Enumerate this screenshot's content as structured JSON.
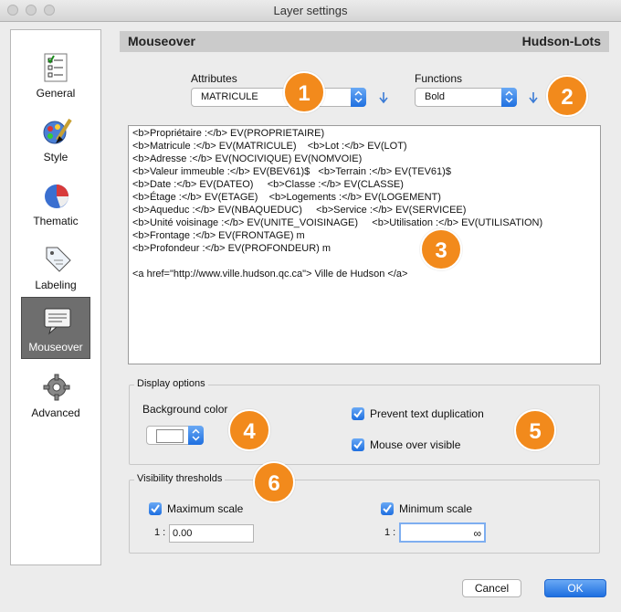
{
  "window": {
    "title": "Layer settings"
  },
  "sidebar": {
    "items": [
      {
        "label": "General",
        "icon": "checklist-icon"
      },
      {
        "label": "Style",
        "icon": "palette-icon"
      },
      {
        "label": "Thematic",
        "icon": "pie-chart-icon"
      },
      {
        "label": "Labeling",
        "icon": "tag-icon"
      },
      {
        "label": "Mouseover",
        "icon": "speech-bubble-icon",
        "active": true
      },
      {
        "label": "Advanced",
        "icon": "gear-icon"
      }
    ]
  },
  "header": {
    "section": "Mouseover",
    "layer": "Hudson-Lots"
  },
  "attributes": {
    "label": "Attributes",
    "value": "MATRICULE"
  },
  "functions": {
    "label": "Functions",
    "value": "Bold"
  },
  "editor": {
    "lines": [
      "<b>Propriétaire :</b> EV(PROPRIETAIRE)",
      "<b>Matricule :</b> EV(MATRICULE)    <b>Lot :</b> EV(LOT)",
      "<b>Adresse :</b> EV(NOCIVIQUE) EV(NOMVOIE)",
      "<b>Valeur immeuble :</b> EV(BEV61)$   <b>Terrain :</b> EV(TEV61)$",
      "<b>Date :</b> EV(DATEO)     <b>Classe :</b> EV(CLASSE)",
      "<b>Étage :</b> EV(ETAGE)    <b>Logements :</b> EV(LOGEMENT)",
      "<b>Aqueduc :</b> EV(NBAQUEDUC)     <b>Service :</b> EV(SERVICEE)",
      "<b>Unité voisinage :</b> EV(UNITE_VOISINAGE)     <b>Utilisation :</b> EV(UTILISATION)",
      "<b>Frontage :</b> EV(FRONTAGE) m",
      "<b>Profondeur :</b> EV(PROFONDEUR) m",
      "",
      "<a href=\"http://www.ville.hudson.qc.ca\"> Ville de Hudson </a>"
    ]
  },
  "display_options": {
    "title": "Display options",
    "background_label": "Background color",
    "background_color": "#ffffff",
    "prevent_dup_label": "Prevent text duplication",
    "prevent_dup_checked": true,
    "mouse_over_label": "Mouse over visible",
    "mouse_over_checked": true
  },
  "visibility": {
    "title": "Visibility thresholds",
    "max_label": "Maximum scale",
    "max_checked": true,
    "max_prefix": "1 :",
    "max_value": "0.00",
    "min_label": "Minimum scale",
    "min_checked": true,
    "min_prefix": "1 :",
    "min_value": "∞"
  },
  "callouts": [
    "1",
    "2",
    "3",
    "4",
    "5",
    "6"
  ],
  "buttons": {
    "cancel": "Cancel",
    "ok": "OK"
  },
  "colors": {
    "accent": "#1e6fe0",
    "callout": "#f28a1c",
    "header_bg": "#cbcbcb"
  }
}
